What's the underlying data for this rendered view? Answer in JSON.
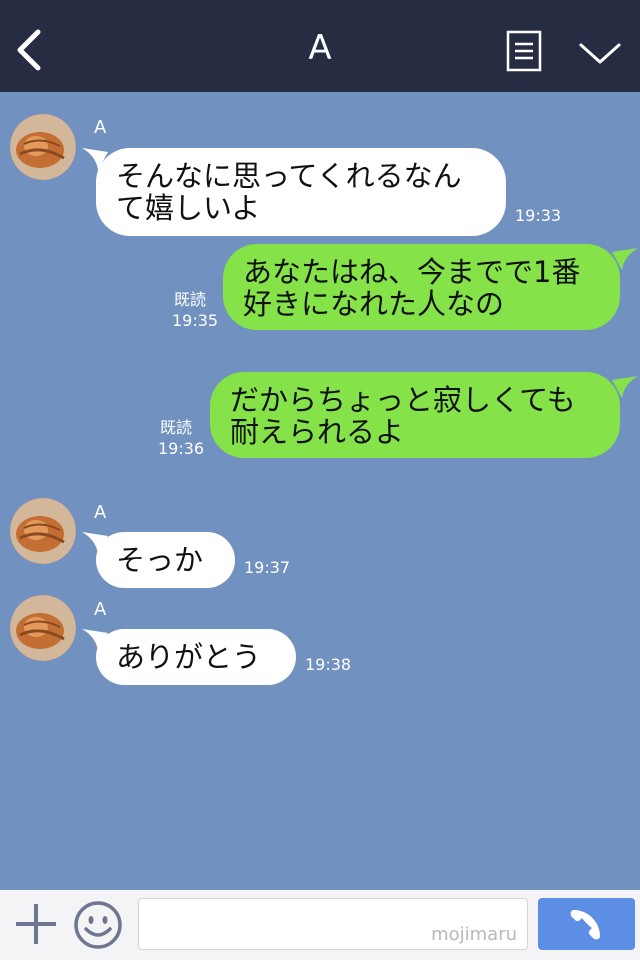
{
  "header": {
    "title": "A"
  },
  "messages": [
    {
      "side": "in",
      "sender": "A",
      "lines": [
        "そんなに思ってくれるなん",
        "て嬉しいよ"
      ],
      "time": "19:33"
    },
    {
      "side": "out",
      "read": "既読",
      "lines": [
        "あなたはね、今までで1番",
        "好きになれた人なの"
      ],
      "time": "19:35"
    },
    {
      "side": "out",
      "read": "既読",
      "lines": [
        "だからちょっと寂しくても",
        "耐えられるよ"
      ],
      "time": "19:36"
    },
    {
      "side": "in",
      "sender": "A",
      "lines": [
        "そっか"
      ],
      "time": "19:37"
    },
    {
      "side": "in",
      "sender": "A",
      "lines": [
        "ありがとう"
      ],
      "time": "19:38"
    }
  ],
  "footer": {
    "watermark": "mojimaru"
  },
  "colors": {
    "header_bg": "#262d42",
    "chat_bg": "#7192c0",
    "incoming_bubble": "#ffffff",
    "outgoing_bubble": "#85e249",
    "call_button": "#5b8ee4"
  },
  "icons": [
    "back-arrow-icon",
    "menu-icon",
    "chevron-down-icon",
    "plus-icon",
    "smile-icon",
    "phone-icon"
  ]
}
